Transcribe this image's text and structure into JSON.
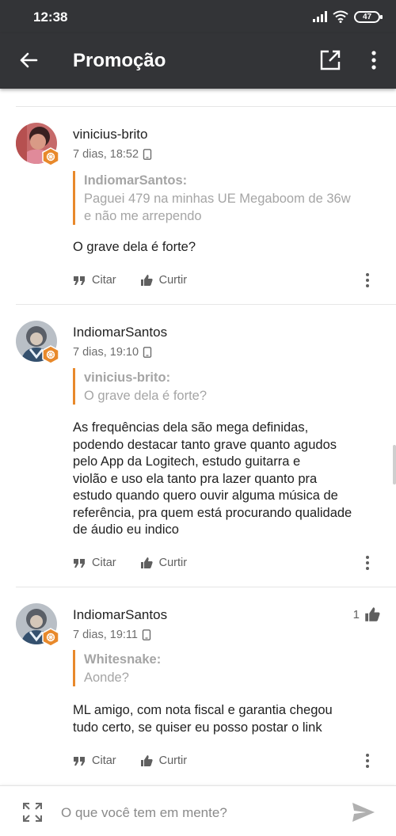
{
  "status_bar": {
    "time": "12:38",
    "battery": "47"
  },
  "app_bar": {
    "title": "Promoção"
  },
  "actions": {
    "quote_label": "Citar",
    "like_label": "Curtir"
  },
  "posts": [
    {
      "author": "vinicius-brito",
      "timestamp": "7 dias, 18:52",
      "quote_author": "IndiomarSantos:",
      "quote_lines": [
        "Paguei 479 na minhas UE Megaboom de 36w",
        "e não me arrependo"
      ],
      "body_lines": [
        "O grave dela é forte?"
      ],
      "likes": ""
    },
    {
      "author": "IndiomarSantos",
      "timestamp": "7 dias, 19:10",
      "quote_author": "vinicius-brito:",
      "quote_lines": [
        "O grave dela é forte?"
      ],
      "body_lines": [
        "As frequências dela são mega definidas,",
        "podendo destacar tanto grave quanto agudos",
        "pelo App da Logitech, estudo guitarra e",
        "violão e uso ela tanto pra lazer quanto pra",
        "estudo quando quero ouvir alguma música de",
        "referência, pra quem está procurando qualidade",
        "de áudio eu indico"
      ],
      "likes": ""
    },
    {
      "author": "IndiomarSantos",
      "timestamp": "7 dias, 19:11",
      "quote_author": "Whitesnake:",
      "quote_lines": [
        "Aonde?"
      ],
      "body_lines": [
        "ML amigo, com nota fiscal e garantia chegou",
        "tudo certo, se quiser eu posso postar o link"
      ],
      "likes": "1"
    }
  ],
  "composer": {
    "placeholder": "O que você tem em mente?"
  },
  "colors": {
    "app_bar": "#333437",
    "quote_accent": "#e8892b",
    "badge": "#e8892b"
  }
}
